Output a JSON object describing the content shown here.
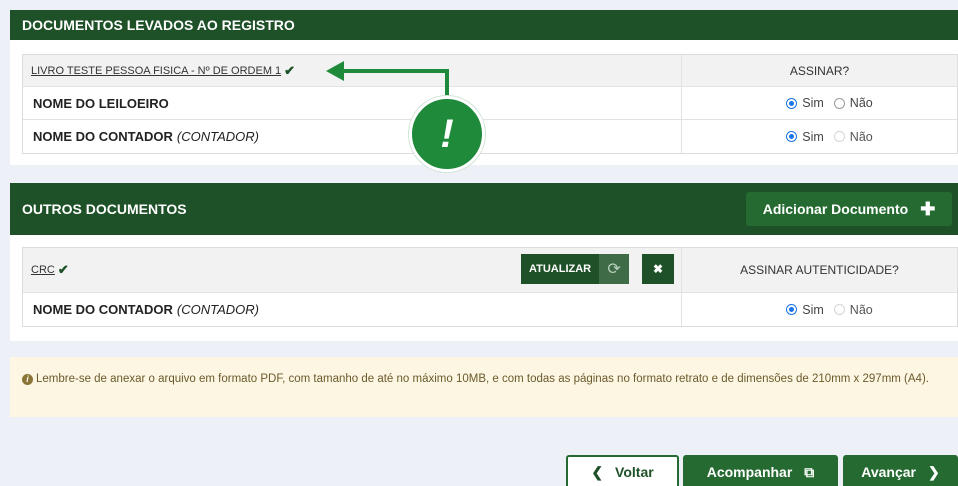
{
  "section1": {
    "title": "DOCUMENTOS LEVADOS AO REGISTRO",
    "doc_link": "LIVRO TESTE PESSOA FISICA - Nº DE ORDEM 1",
    "sign_header": "ASSINAR?",
    "rows": [
      {
        "name": "NOME DO LEILOEIRO",
        "sub": "",
        "yes": "Sim",
        "no": "Não",
        "selected": "Sim",
        "no_disabled": false
      },
      {
        "name": "NOME DO CONTADOR",
        "sub": "(CONTADOR)",
        "yes": "Sim",
        "no": "Não",
        "selected": "Sim",
        "no_disabled": true
      }
    ]
  },
  "annotation": {
    "symbol": "!",
    "color": "#1e8a3a"
  },
  "section2": {
    "title": "OUTROS DOCUMENTOS",
    "add_button": "Adicionar Documento",
    "doc_link": "CRC",
    "update_button": "ATUALIZAR",
    "close_button": "✖",
    "sign_header": "ASSINAR AUTENTICIDADE?",
    "row": {
      "name": "NOME DO CONTADOR",
      "sub": "(CONTADOR)",
      "yes": "Sim",
      "no": "Não",
      "selected": "Sim"
    }
  },
  "notice": {
    "text": "Lembre-se de anexar o arquivo em formato PDF, com tamanho de até no máximo 10MB, e com todas as páginas no formato retrato e de dimensões de 210mm x 297mm (A4)."
  },
  "footer": {
    "back": "Voltar",
    "track": "Acompanhar",
    "next": "Avançar"
  },
  "colors": {
    "primary": "#1e5128",
    "button": "#256b31",
    "radio": "#1a73e8",
    "notice_bg": "#fdf6e3"
  }
}
